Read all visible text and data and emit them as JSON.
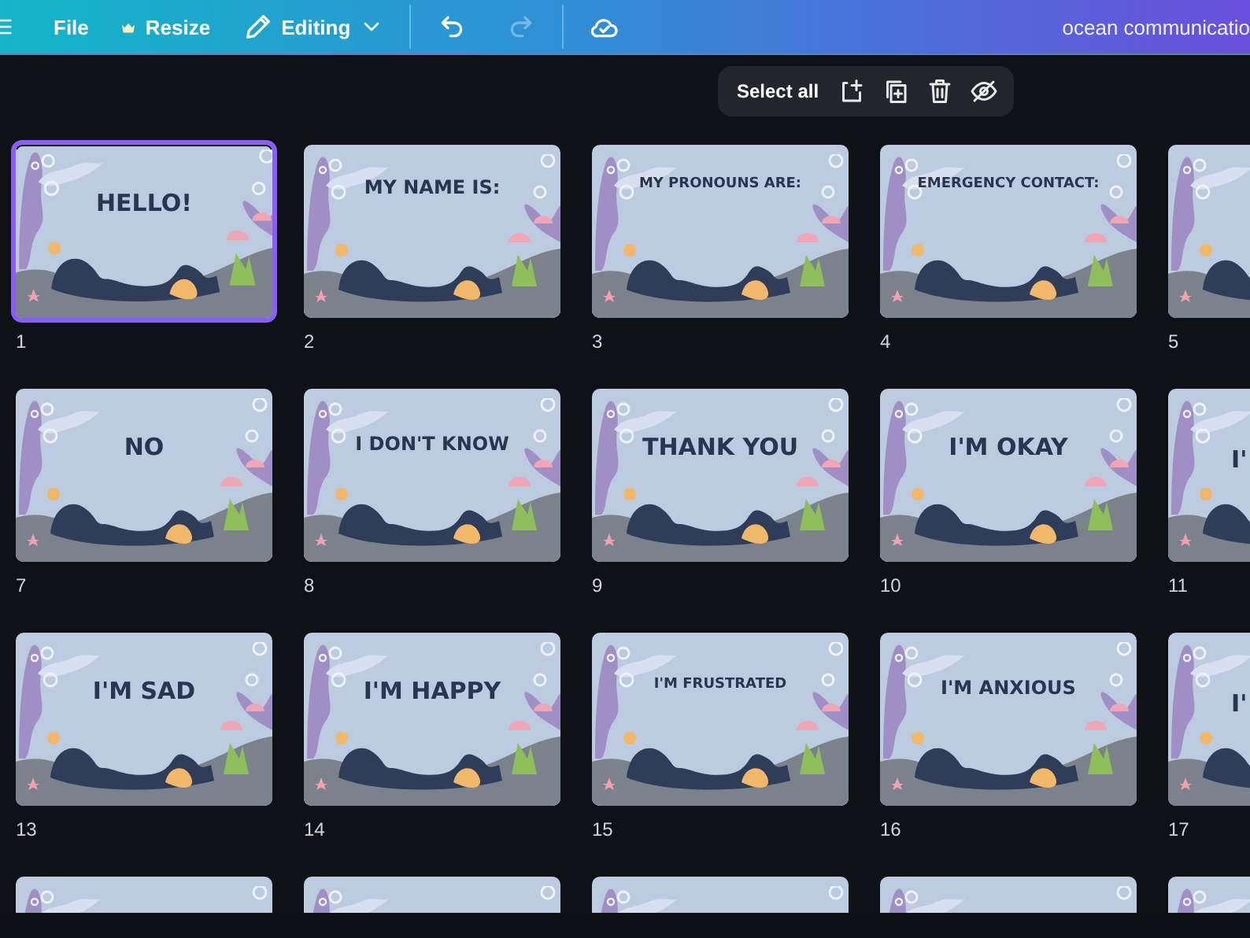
{
  "top_bar": {
    "menu": "File",
    "resize": "Resize",
    "mode": "Editing",
    "redo_disabled": true,
    "title": "ocean communicatio"
  },
  "page_toolbar": {
    "select_all": "Select all"
  },
  "rows": [
    {
      "pages": [
        {
          "number": "1",
          "text": "HELLO!",
          "selected": true,
          "partial": false
        },
        {
          "number": "2",
          "text": "MY NAME IS:",
          "selected": false,
          "partial": false
        },
        {
          "number": "3",
          "text": "MY PRONOUNS ARE:",
          "selected": false,
          "partial": false
        },
        {
          "number": "4",
          "text": "EMERGENCY CONTACT:",
          "selected": false,
          "partial": false
        },
        {
          "number": "5",
          "selected": false,
          "partial": true
        }
      ]
    },
    {
      "pages": [
        {
          "number": "7",
          "text": "NO",
          "selected": false,
          "partial": false
        },
        {
          "number": "8",
          "text": "I DON'T KNOW",
          "selected": false,
          "partial": false
        },
        {
          "number": "9",
          "text": "THANK YOU",
          "selected": false,
          "partial": false
        },
        {
          "number": "10",
          "text": "I'M OKAY",
          "selected": false,
          "partial": false
        },
        {
          "number": "11",
          "text": "I'",
          "selected": false,
          "partial": true
        }
      ]
    },
    {
      "pages": [
        {
          "number": "13",
          "text": "I'M SAD",
          "selected": false,
          "partial": false
        },
        {
          "number": "14",
          "text": "I'M HAPPY",
          "selected": false,
          "partial": false
        },
        {
          "number": "15",
          "text": "I'M FRUSTRATED",
          "selected": false,
          "partial": false
        },
        {
          "number": "16",
          "text": "I'M ANXIOUS",
          "selected": false,
          "partial": false
        },
        {
          "number": "17",
          "text": "I'",
          "selected": false,
          "partial": true
        }
      ]
    },
    {
      "pages": [
        {
          "selected": false,
          "partial": false
        },
        {
          "selected": false,
          "partial": false
        },
        {
          "selected": false,
          "partial": false
        },
        {
          "selected": false,
          "partial": false
        },
        {
          "selected": false,
          "partial": true
        }
      ]
    }
  ]
}
